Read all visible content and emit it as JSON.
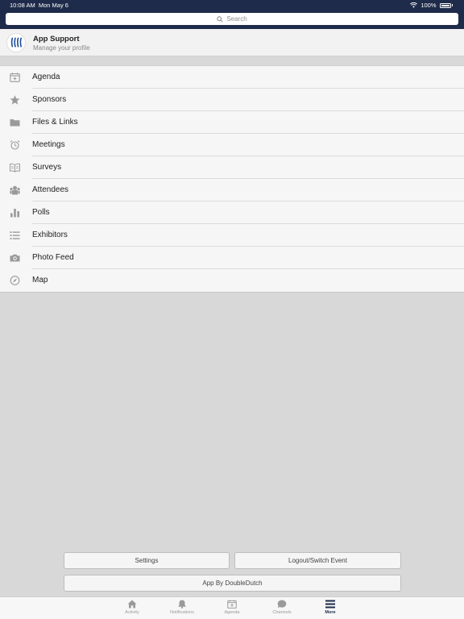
{
  "status_bar": {
    "time": "10:08 AM",
    "date": "Mon May 6",
    "battery": "100%"
  },
  "search": {
    "placeholder": "Search"
  },
  "profile": {
    "name": "App Support",
    "subtitle": "Manage your profile"
  },
  "menu": {
    "items": [
      {
        "label": "Agenda",
        "icon": "calendar-icon"
      },
      {
        "label": "Sponsors",
        "icon": "star-icon"
      },
      {
        "label": "Files & Links",
        "icon": "folder-icon"
      },
      {
        "label": "Meetings",
        "icon": "alarm-clock-icon"
      },
      {
        "label": "Surveys",
        "icon": "open-book-icon"
      },
      {
        "label": "Attendees",
        "icon": "people-icon"
      },
      {
        "label": "Polls",
        "icon": "bar-chart-icon"
      },
      {
        "label": "Exhibitors",
        "icon": "list-icon"
      },
      {
        "label": "Photo Feed",
        "icon": "camera-icon"
      },
      {
        "label": "Map",
        "icon": "compass-icon"
      }
    ]
  },
  "buttons": {
    "settings": "Settings",
    "logout": "Logout/Switch Event",
    "app_by": "App By DoubleDutch"
  },
  "tabbar": {
    "tabs": [
      {
        "label": "Activity",
        "icon": "home-icon"
      },
      {
        "label": "Notifications",
        "icon": "bell-icon"
      },
      {
        "label": "Agenda",
        "icon": "calendar-icon"
      },
      {
        "label": "Channels",
        "icon": "chat-bubble-icon"
      },
      {
        "label": "More",
        "icon": "hamburger-menu-icon",
        "active": true
      }
    ]
  },
  "colors": {
    "header_bg": "#1f2b4a",
    "page_bg": "#d8d8d8",
    "icon_gray": "#9a9a9a"
  }
}
